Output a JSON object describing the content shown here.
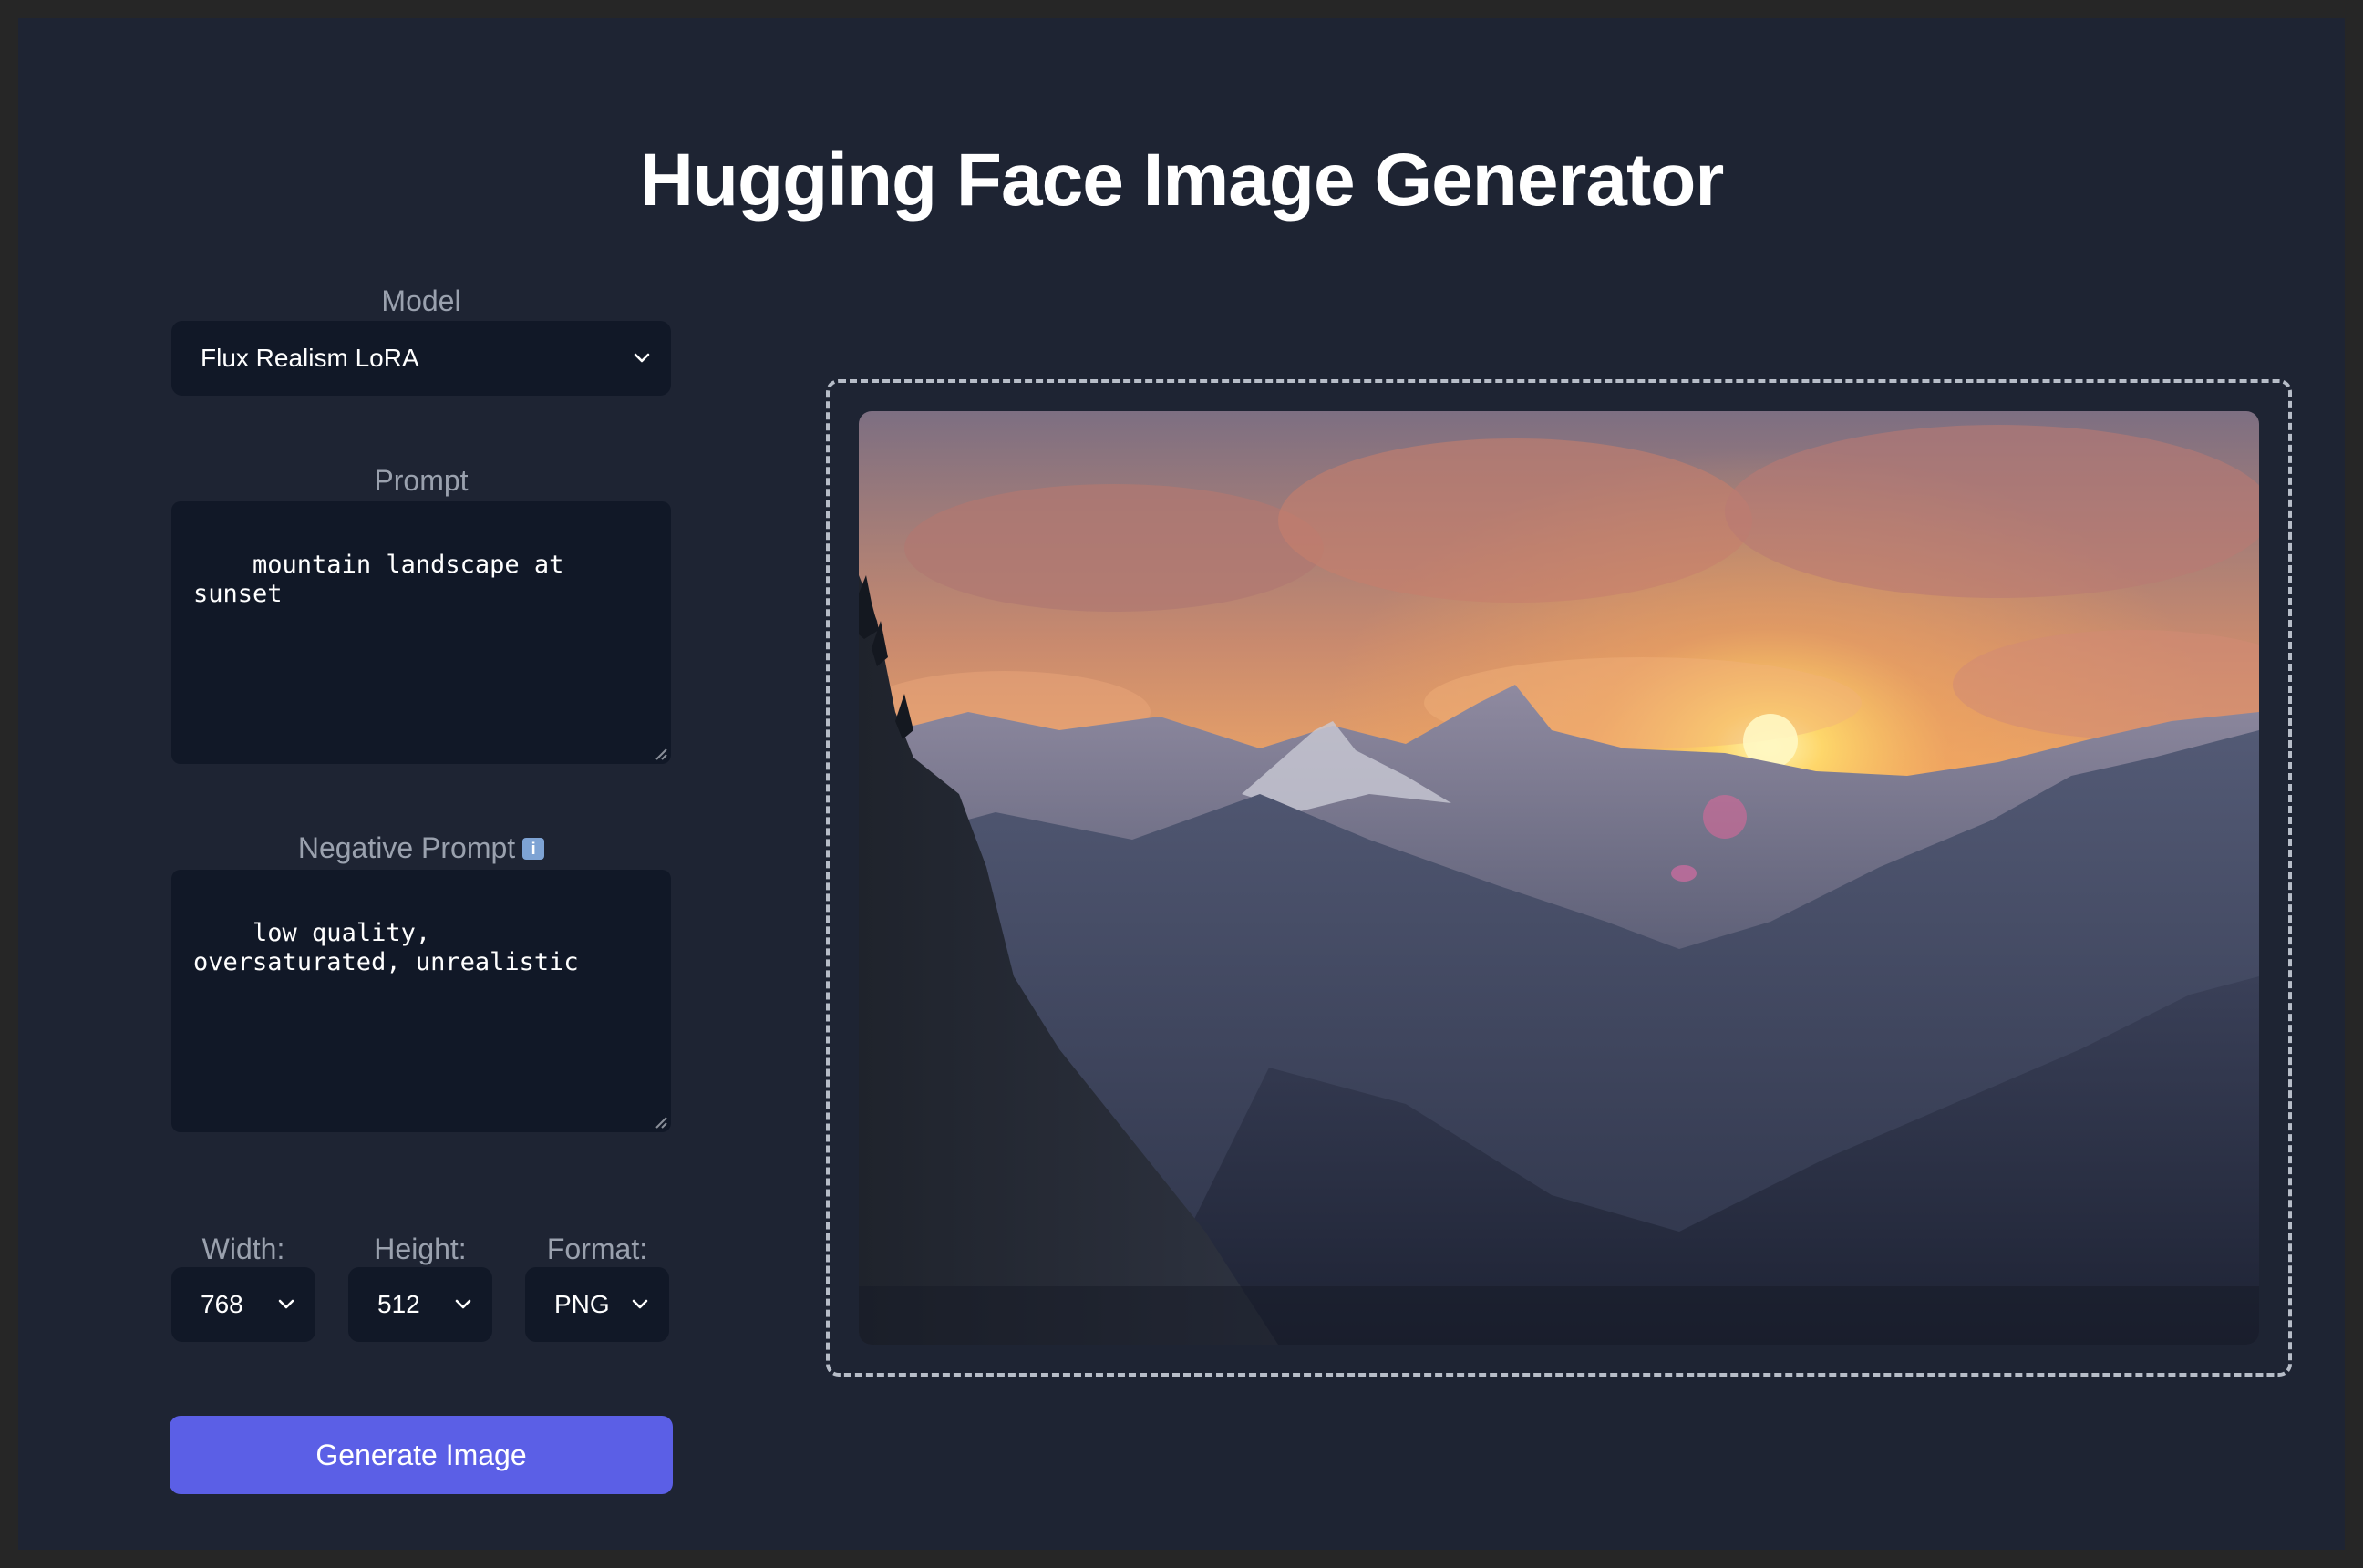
{
  "header": {
    "title": "Hugging Face Image Generator"
  },
  "model": {
    "label": "Model",
    "selected": "Flux Realism LoRA"
  },
  "prompt": {
    "label": "Prompt",
    "value": "mountain landscape at sunset"
  },
  "negative_prompt": {
    "label": "Negative Prompt",
    "info_icon": "info-icon",
    "info_glyph": "i",
    "value": "low quality, oversaturated, unrealistic"
  },
  "settings": {
    "width": {
      "label": "Width:",
      "selected": "768"
    },
    "height": {
      "label": "Height:",
      "selected": "512"
    },
    "format": {
      "label": "Format:",
      "selected": "PNG"
    }
  },
  "actions": {
    "generate_label": "Generate Image"
  },
  "preview": {
    "image_description": "generated-image",
    "accent_color": "#5b5fe6"
  }
}
